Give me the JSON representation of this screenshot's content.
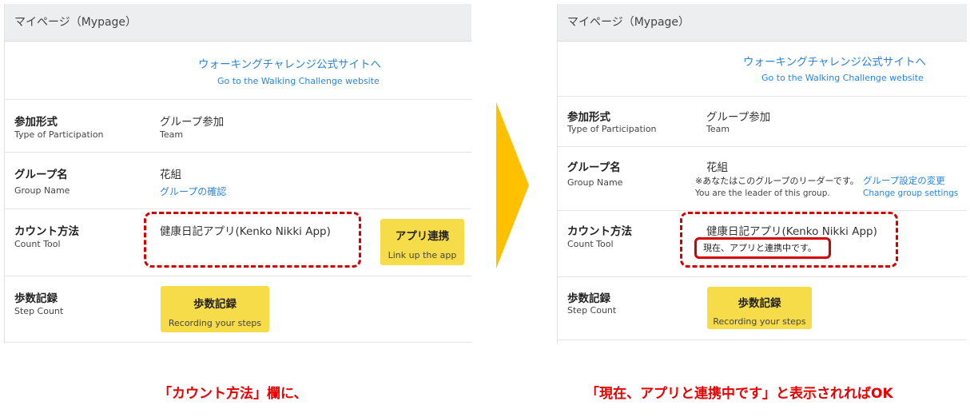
{
  "header": {
    "title": "マイページ（Mypage）"
  },
  "site_link": {
    "ja": "ウォーキングチャレンジ公式サイトへ",
    "en": "Go to the Walking Challenge website"
  },
  "rows": {
    "participation": {
      "label_ja": "参加形式",
      "label_en": "Type of Participation",
      "value_ja": "グループ参加",
      "value_en": "Team"
    },
    "group": {
      "label_ja": "グループ名",
      "label_en": "Group Name",
      "value": "花組",
      "confirm_link": "グループの確認"
    },
    "count": {
      "label_ja": "カウント方法",
      "label_en": "Count Tool",
      "value": "健康日記アプリ(Kenko Nikki App)"
    },
    "steps": {
      "label_ja": "歩数記録",
      "label_en": "Step Count"
    }
  },
  "buttons": {
    "link_app": {
      "ja": "アプリ連携",
      "en": "Link up the app"
    },
    "record_steps": {
      "ja": "歩数記録",
      "en": "Recording your steps"
    }
  },
  "after": {
    "leader_ja": "※あなたはこのグループのリーダーです。",
    "group_settings_ja": "グループ設定の変更",
    "leader_en": "You are the leader of this group.",
    "group_settings_en": "Change group settings",
    "linked_status": "現在、アプリと連携中です。"
  },
  "captions": {
    "left": "「カウント方法」欄に、",
    "right": "「現在、アプリと連携中です」と表示されればOK"
  },
  "colors": {
    "accent_yellow": "#f7dc4a",
    "arrow": "#ffc000",
    "highlight_red": "#d40000",
    "link_blue": "#2a85d8"
  }
}
